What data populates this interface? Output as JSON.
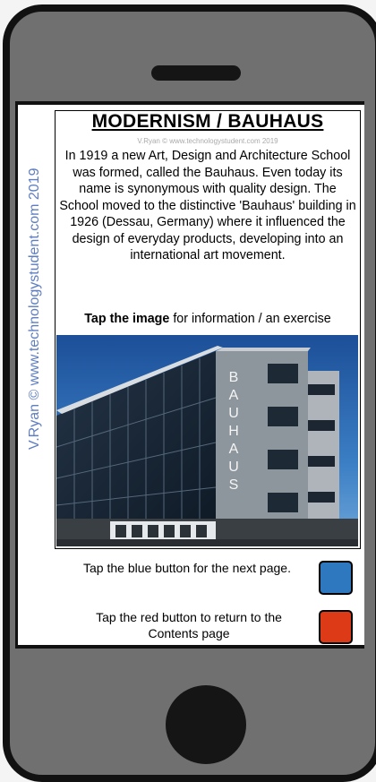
{
  "page": {
    "title": "MODERNISM / BAUHAUS",
    "credit_small": "V.Ryan © www.technologystudent.com 2019",
    "side_credit": "V.Ryan © www.technologystudent.com 2019",
    "body": "In 1919 a new Art, Design and Architecture School was formed, called the Bauhaus. Even today its name is synonymous with quality design. The School moved to the distinctive 'Bauhaus' building in 1926 (Dessau, Germany) where it influenced the design of everyday products, developing into an international art movement.",
    "tap_bold": "Tap the image",
    "tap_rest": " for information / an exercise",
    "building_sign": [
      "B",
      "A",
      "U",
      "H",
      "A",
      "U",
      "S"
    ]
  },
  "navigation": {
    "next_text": "Tap the blue button for the next page.",
    "contents_text": "Tap the red button to return to the Contents page",
    "next_color": "#2e78c0",
    "contents_color": "#dd3b17"
  },
  "phone": {
    "body_color": "#707070",
    "frame_color": "#111111"
  }
}
